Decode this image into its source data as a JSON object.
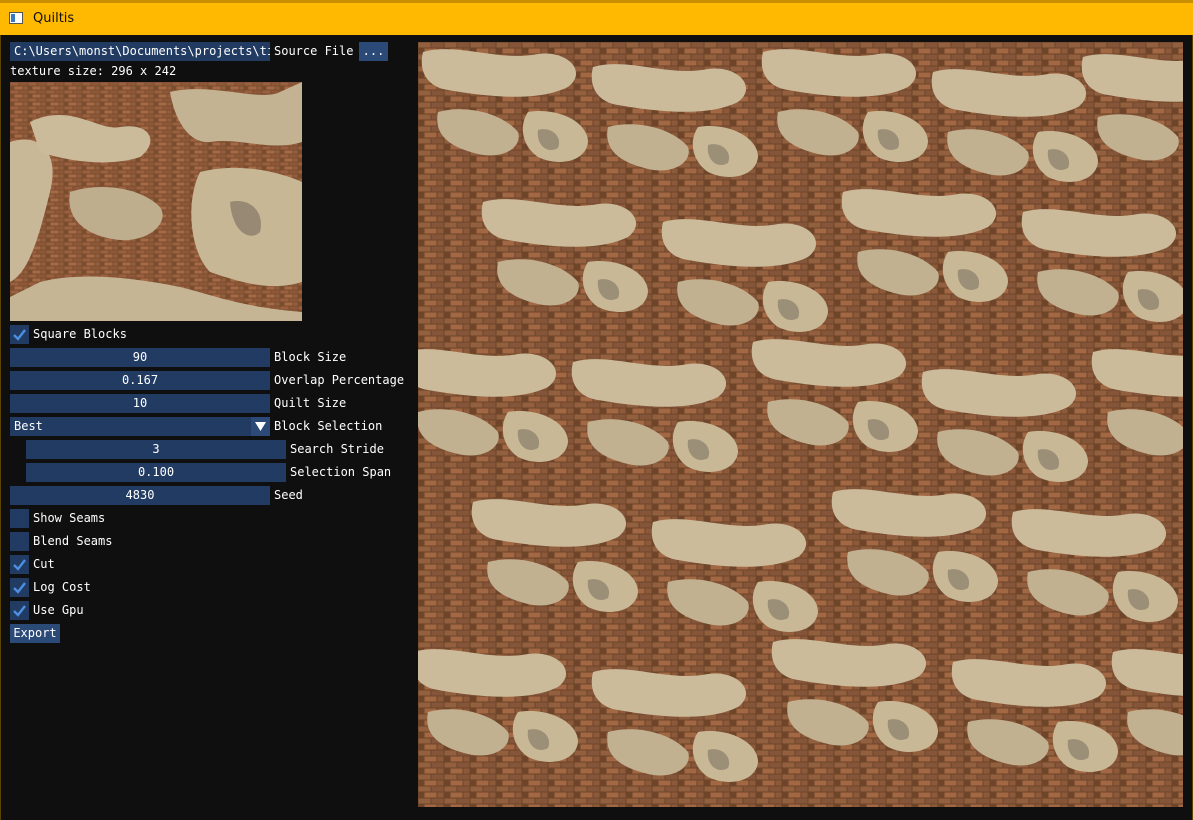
{
  "window": {
    "title": "Quiltis"
  },
  "source": {
    "path_value": "C:\\Users\\monst\\Documents\\projects\\til",
    "label": "Source File",
    "browse_label": "...",
    "texture_size": "texture size: 296 x 242"
  },
  "controls": {
    "square_blocks": {
      "label": "Square Blocks",
      "checked": true
    },
    "block_size": {
      "value": "90",
      "label": "Block Size"
    },
    "overlap": {
      "value": "0.167",
      "label": "Overlap Percentage"
    },
    "quilt_size": {
      "value": "10",
      "label": "Quilt Size"
    },
    "block_selection": {
      "value": "Best",
      "label": "Block Selection"
    },
    "search_stride": {
      "value": "3",
      "label": "Search Stride"
    },
    "selection_span": {
      "value": "0.100",
      "label": "Selection Span"
    },
    "seed": {
      "value": "4830",
      "label": "Seed"
    },
    "show_seams": {
      "label": "Show Seams",
      "checked": false
    },
    "blend_seams": {
      "label": "Blend Seams",
      "checked": false
    },
    "cut": {
      "label": "Cut",
      "checked": true
    },
    "log_cost": {
      "label": "Log Cost",
      "checked": true
    },
    "use_gpu": {
      "label": "Use Gpu",
      "checked": true
    },
    "export_label": "Export"
  },
  "colors": {
    "titlebar": "#ffb900",
    "widget_bg": "#213b63",
    "button_bg": "#2b4a78",
    "check": "#4d8fe0",
    "plaster": "#c9b898",
    "brick": "#8a5a3a"
  },
  "icons": {
    "app": "app-window-icon",
    "check": "checkmark-icon",
    "dropdown": "triangle-down-icon"
  }
}
